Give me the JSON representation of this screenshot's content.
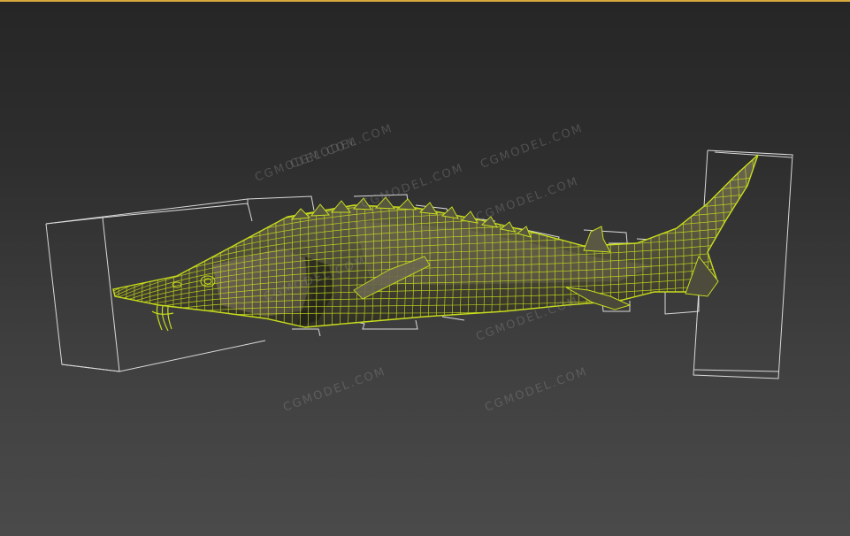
{
  "viewport": {
    "background_top": "#262626",
    "background_bottom": "#4a4a4a",
    "active_border_color": "#d7a83c",
    "wireframe_color": "#c8dd1c",
    "bounding_box_color": "#d9d9d9",
    "model_body_color": "#5a5843"
  },
  "watermarks": [
    {
      "text": "CGMODEL.COM"
    },
    {
      "text": "CGMODEL.COM"
    },
    {
      "text": "CGMODEL.COM"
    },
    {
      "text": "CGMODEL.COM"
    },
    {
      "text": "CGMODEL.COM"
    },
    {
      "text": "CGMODEL.COM"
    },
    {
      "text": "CGMODEL.COM"
    },
    {
      "text": "CGMODEL.COM"
    },
    {
      "text": "CGMODEL.COM"
    }
  ]
}
